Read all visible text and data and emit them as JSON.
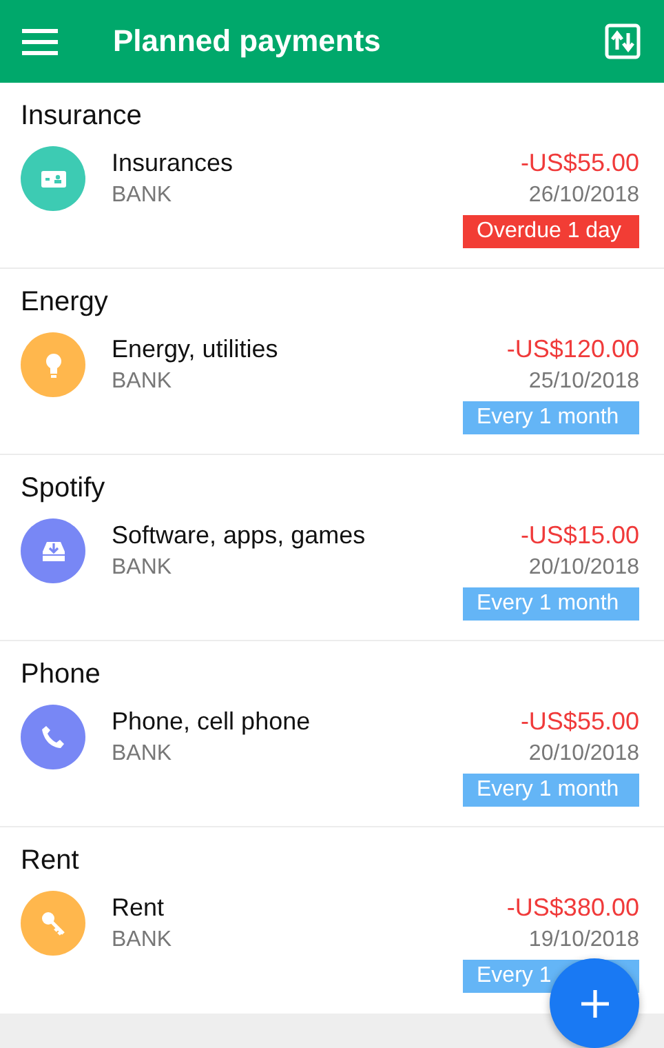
{
  "app_bar": {
    "title": "Planned payments"
  },
  "groups": [
    {
      "title": "Insurance",
      "payment": {
        "color": "#3dcbb3",
        "category": "Insurances",
        "account": "BANK",
        "amount": "-US$55.00",
        "date": "26/10/2018",
        "tag": {
          "kind": "overdue",
          "text": "Overdue 1 day"
        }
      }
    },
    {
      "title": "Energy",
      "payment": {
        "color": "#ffb74d",
        "category": "Energy, utilities",
        "account": "BANK",
        "amount": "-US$120.00",
        "date": "25/10/2018",
        "tag": {
          "kind": "recurring",
          "text": "Every 1 month"
        }
      }
    },
    {
      "title": "Spotify",
      "payment": {
        "color": "#7887f5",
        "category": "Software, apps, games",
        "account": "BANK",
        "amount": "-US$15.00",
        "date": "20/10/2018",
        "tag": {
          "kind": "recurring",
          "text": "Every 1 month"
        }
      }
    },
    {
      "title": "Phone",
      "payment": {
        "color": "#7887f5",
        "category": "Phone, cell phone",
        "account": "BANK",
        "amount": "-US$55.00",
        "date": "20/10/2018",
        "tag": {
          "kind": "recurring",
          "text": "Every 1 month"
        }
      }
    },
    {
      "title": "Rent",
      "payment": {
        "color": "#ffb74d",
        "category": "Rent",
        "account": "BANK",
        "amount": "-US$380.00",
        "date": "19/10/2018",
        "tag": {
          "kind": "recurring",
          "text": "Every 1"
        }
      }
    }
  ]
}
